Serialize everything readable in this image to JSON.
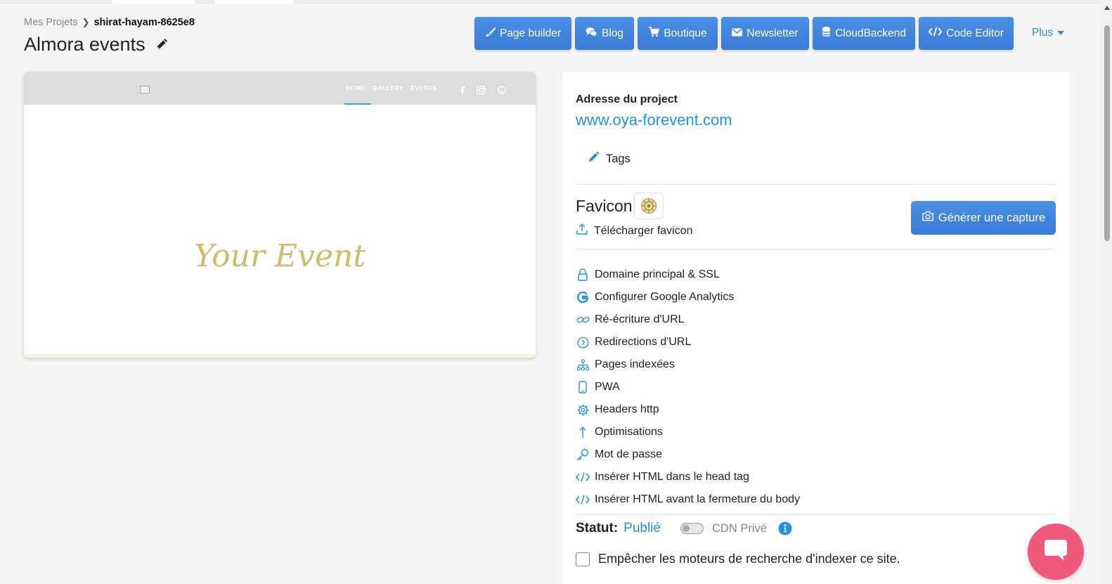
{
  "breadcrumb": {
    "parent": "Mes Projets",
    "current": "shirat-hayam-8625e8"
  },
  "project": {
    "title": "Almora events"
  },
  "toolbar": {
    "buttons": [
      {
        "label": "Page builder",
        "icon": "brush-icon"
      },
      {
        "label": "Blog",
        "icon": "comments-icon"
      },
      {
        "label": "Boutique",
        "icon": "cart-icon"
      },
      {
        "label": "Newsletter",
        "icon": "envelope-icon"
      },
      {
        "label": "CloudBackend",
        "icon": "database-icon"
      },
      {
        "label": "Code Editor",
        "icon": "code-icon"
      }
    ],
    "more_label": "Plus"
  },
  "preview": {
    "nav": [
      "HOME",
      "GALLERY",
      "EVENTS"
    ],
    "hero_text": "Your Event"
  },
  "panel": {
    "address_label": "Adresse du project",
    "address_url": "www.oya-forevent.com",
    "tags_label": "Tags",
    "favicon_label": "Favicon",
    "upload_favicon_label": "Télécharger favicon",
    "capture_button": "Générer une capture",
    "menu": [
      {
        "label": "Domaine principal & SSL",
        "icon": "lock-icon"
      },
      {
        "label": "Configurer Google Analytics",
        "icon": "google-icon"
      },
      {
        "label": "Ré-écriture d'URL",
        "icon": "link-icon"
      },
      {
        "label": "Redirections d'URL",
        "icon": "chevron-circle-icon"
      },
      {
        "label": "Pages indexées",
        "icon": "sitemap-icon"
      },
      {
        "label": "PWA",
        "icon": "mobile-icon"
      },
      {
        "label": "Headers http",
        "icon": "gear-icon"
      },
      {
        "label": "Optimisations",
        "icon": "arrow-up-icon"
      },
      {
        "label": "Mot de passe",
        "icon": "key-icon"
      },
      {
        "label": "Insérer HTML dans le head tag",
        "icon": "code-icon"
      },
      {
        "label": "Insérer HTML avant la fermeture du body",
        "icon": "code-icon"
      }
    ],
    "status_label": "Statut:",
    "status_value": "Publié",
    "cdn_label": "CDN Privé",
    "noindex_label": "Empêcher les moteurs de recherche d'indexer ce site."
  },
  "colors": {
    "accent": "#3a7bd5",
    "link": "#1f93e0",
    "chat": "#f05a7a",
    "hero": "#cdbd6a"
  }
}
